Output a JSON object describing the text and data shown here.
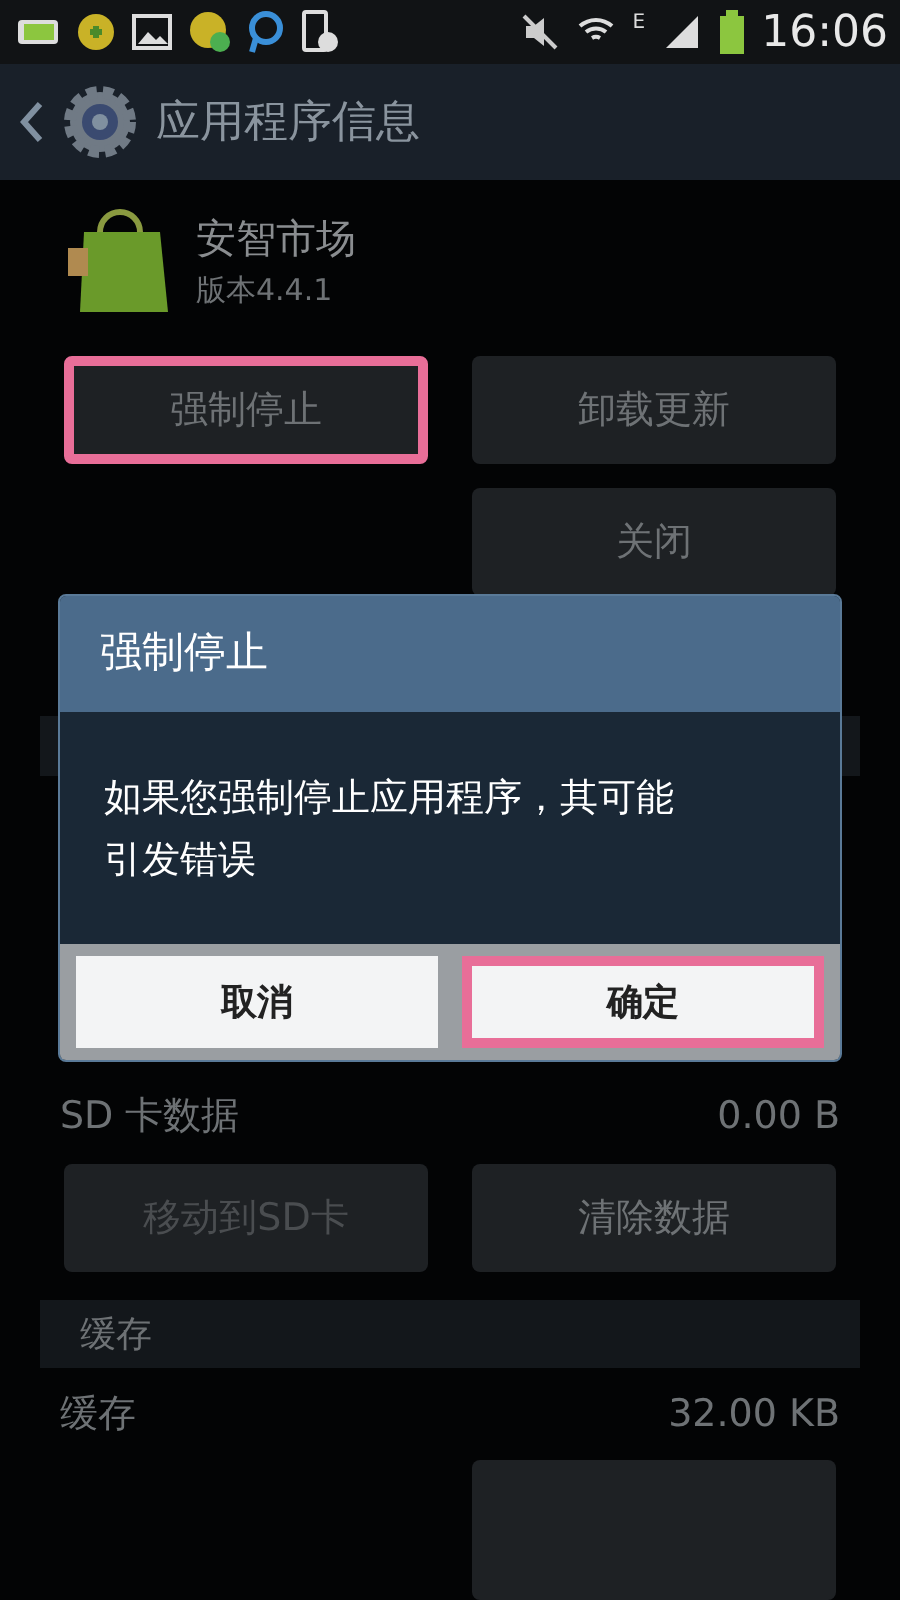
{
  "status_bar": {
    "time": "16:06",
    "network": "E"
  },
  "title_bar": {
    "title": "应用程序信息"
  },
  "app": {
    "name": "安智市场",
    "version": "版本4.4.1"
  },
  "actions": [
    {
      "label": "强制停止",
      "highlighted": true
    },
    {
      "label": "卸载更新",
      "highlighted": false
    },
    {
      "label": "关闭",
      "highlighted": false
    }
  ],
  "storage": {
    "rows": [
      {
        "label": "SD 卡数据",
        "value": "0.00 B"
      }
    ],
    "buttons": [
      {
        "label": "移动到SD卡",
        "disabled": true
      },
      {
        "label": "清除数据",
        "disabled": false
      }
    ]
  },
  "cache": {
    "header": "缓存",
    "rows": [
      {
        "label": "缓存",
        "value": "32.00 KB"
      }
    ]
  },
  "dialog": {
    "title": "强制停止",
    "message": "如果您强制停止应用程序，其可能引发错误",
    "buttons": [
      {
        "label": "取消",
        "highlighted": false
      },
      {
        "label": "确定",
        "highlighted": true
      }
    ]
  }
}
